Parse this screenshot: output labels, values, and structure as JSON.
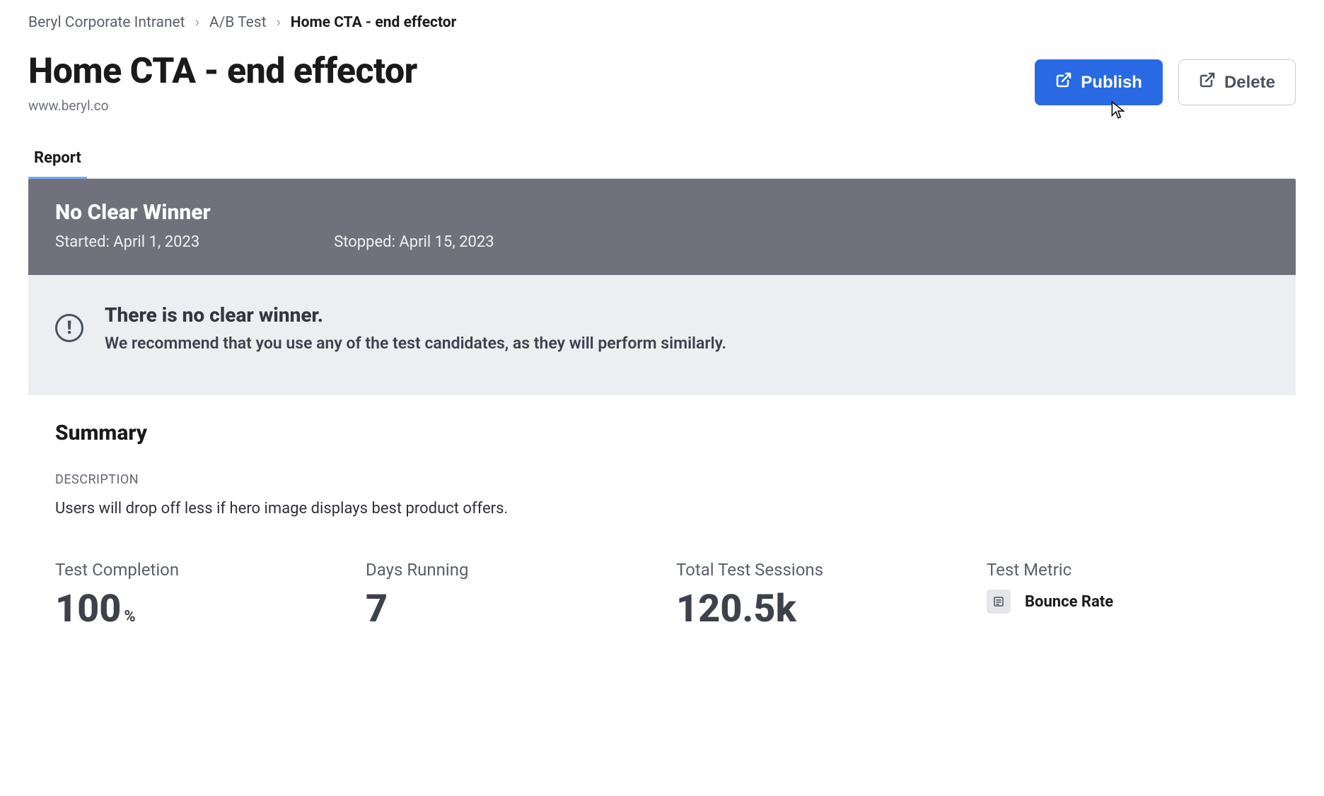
{
  "breadcrumb": {
    "items": [
      "Beryl Corporate Intranet",
      "A/B Test",
      "Home CTA - end effector"
    ]
  },
  "header": {
    "title": "Home CTA - end effector",
    "subtitle": "www.beryl.co",
    "publish_label": "Publish",
    "delete_label": "Delete"
  },
  "tabs": [
    {
      "label": "Report",
      "active": true
    }
  ],
  "banner": {
    "title": "No Clear Winner",
    "started_label": "Started: April 1, 2023",
    "stopped_label": "Stopped: April 15, 2023"
  },
  "note": {
    "heading": "There is no clear winner.",
    "body": "We recommend that you use any of the test candidates, as they will perform similarly."
  },
  "summary": {
    "title": "Summary",
    "description_label": "DESCRIPTION",
    "description": "Users will drop off less if hero image displays best product offers.",
    "stats": {
      "completion": {
        "label": "Test Completion",
        "value": "100",
        "unit": "%"
      },
      "days": {
        "label": "Days Running",
        "value": "7"
      },
      "sessions": {
        "label": "Total Test Sessions",
        "value": "120.5k"
      },
      "metric": {
        "label": "Test Metric",
        "name": "Bounce Rate"
      }
    }
  }
}
